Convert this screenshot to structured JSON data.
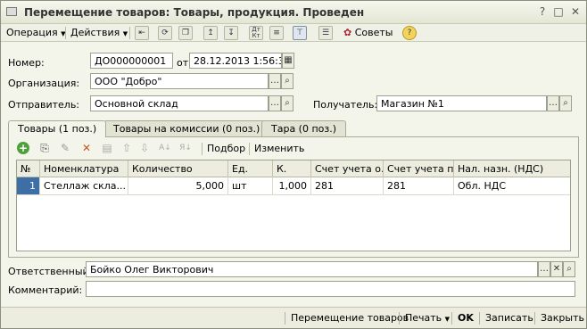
{
  "window": {
    "title": "Перемещение товаров: Товары, продукция. Проведен"
  },
  "toolbar": {
    "operation_label": "Операция",
    "actions_label": "Действия",
    "advice_label": "Советы",
    "icons": [
      "go-to-icon",
      "refresh-icon",
      "copy-doc-icon",
      "post-icon",
      "unpost-icon",
      "dt-kt-icon",
      "structure-icon",
      "filter-icon",
      "report-icon"
    ]
  },
  "header": {
    "number_label": "Номер:",
    "number_value": "ДО000000001",
    "date_label": "от:",
    "date_value": "28.12.2013  1:56:31",
    "org_label": "Организация:",
    "org_value": "ООО \"Добро\"",
    "sender_label": "Отправитель:",
    "sender_value": "Основной склад",
    "receiver_label": "Получатель:",
    "receiver_value": "Магазин №1"
  },
  "tabs": [
    {
      "label": "Товары (1 поз.)",
      "active": true
    },
    {
      "label": "Товары на комиссии (0 поз.)",
      "active": false
    },
    {
      "label": "Тара (0 поз.)",
      "active": false
    }
  ],
  "grid_toolbar": {
    "selection_label": "Подбор",
    "change_label": "Изменить"
  },
  "grid": {
    "columns": [
      "№",
      "Номенклатура",
      "Количество",
      "Ед.",
      "К.",
      "Счет учета о...",
      "Счет учета п...",
      "Нал. назн. (НДС)"
    ],
    "rows": [
      [
        "1",
        "Стеллаж скла...",
        "5,000",
        "шт",
        "1,000",
        "281",
        "281",
        "Обл. НДС"
      ]
    ]
  },
  "footer_fields": {
    "responsible_label": "Ответственный:",
    "responsible_value": "Бойко Олег Викторович",
    "comment_label": "Комментарий:",
    "comment_value": ""
  },
  "statusbar": {
    "move_goods": "Перемещение товаров",
    "print": "Печать",
    "ok": "OK",
    "save": "Записать",
    "close": "Закрыть"
  }
}
